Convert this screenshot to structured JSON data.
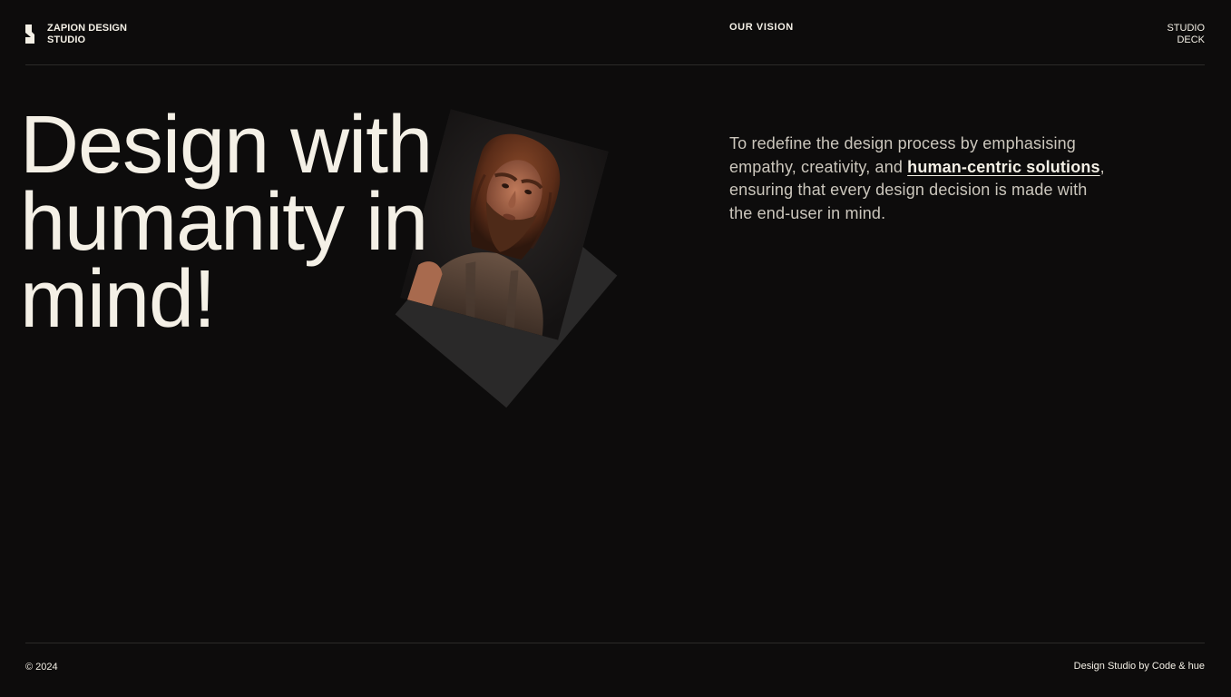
{
  "header": {
    "brand_name": "ZAPION DESIGN STUDIO",
    "nav_label": "OUR VISION",
    "deck_label": "STUDIO DECK"
  },
  "hero": {
    "headline_lines": [
      "Design with",
      "humanity in",
      "mind!"
    ],
    "photo_icon": "caveman-portrait-image"
  },
  "vision": {
    "text_before_link": "To redefine the design process by emphasising empathy, creativity, and ",
    "link_text": "human-centric solutions",
    "text_after_link": ", ensuring that every design decision is made with the end-user in mind."
  },
  "footer": {
    "copyright": "© 2024",
    "credit": "Design Studio by Code & hue"
  },
  "colors": {
    "background": "#0d0c0c",
    "text_primary": "#f4f0e6",
    "text_secondary": "#cbc6bc",
    "divider": "#2b2a29"
  }
}
